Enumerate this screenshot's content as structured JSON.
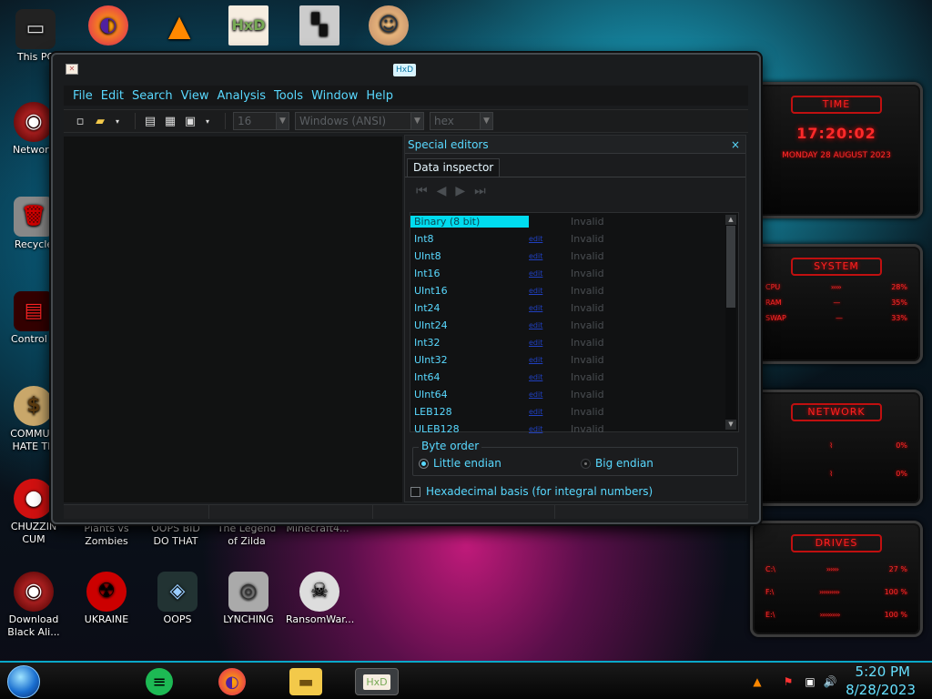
{
  "desktop_icons": [
    {
      "label": "This PC"
    },
    {
      "label": "Network"
    },
    {
      "label": "Recycle"
    },
    {
      "label": "Control P"
    },
    {
      "label": "COMMUN HATE TH"
    },
    {
      "label": "CHUZZIN CUM"
    },
    {
      "label": "Plants vs Zombies"
    },
    {
      "label": "OOPS BID DO THAT"
    },
    {
      "label": "The Legend of Zilda"
    },
    {
      "label": "Minecraft4..."
    },
    {
      "label": "Download Black Ali..."
    },
    {
      "label": "UKRAINE"
    },
    {
      "label": "OOPS"
    },
    {
      "label": "LYNCHING"
    },
    {
      "label": "RansomWar..."
    }
  ],
  "gadgets": {
    "time": {
      "title": "TIME",
      "clock": "17:20:02",
      "date": "MONDAY 28 AUGUST 2023"
    },
    "system": {
      "title": "SYSTEM",
      "rows": [
        {
          "label": "CPU",
          "value": "28%"
        },
        {
          "label": "RAM",
          "value": "35%"
        },
        {
          "label": "SWAP",
          "value": "33%"
        }
      ]
    },
    "network": {
      "title": "NETWORK",
      "rows": [
        {
          "label": "",
          "value": "0%"
        },
        {
          "label": "",
          "value": "0%"
        }
      ]
    },
    "drives": {
      "title": "DRIVES",
      "rows": [
        {
          "label": "C:\\",
          "value": "27 %"
        },
        {
          "label": "F:\\",
          "value": "100 %"
        },
        {
          "label": "E:\\",
          "value": "100 %"
        }
      ]
    }
  },
  "window": {
    "title": "HxD",
    "menu": [
      "File",
      "Edit",
      "Search",
      "View",
      "Analysis",
      "Tools",
      "Window",
      "Help"
    ],
    "toolbar": {
      "bytes_per_row": "16",
      "charset": "Windows (ANSI)",
      "offset_base": "hex"
    },
    "special_editors": {
      "title": "Special editors",
      "close": "×",
      "tab": "Data inspector",
      "rows": [
        {
          "name": "Binary (8 bit)",
          "value": "Invalid",
          "selected": true
        },
        {
          "name": "Int8",
          "edit": "edit",
          "value": "Invalid"
        },
        {
          "name": "UInt8",
          "edit": "edit",
          "value": "Invalid"
        },
        {
          "name": "Int16",
          "edit": "edit",
          "value": "Invalid"
        },
        {
          "name": "UInt16",
          "edit": "edit",
          "value": "Invalid"
        },
        {
          "name": "Int24",
          "edit": "edit",
          "value": "Invalid"
        },
        {
          "name": "UInt24",
          "edit": "edit",
          "value": "Invalid"
        },
        {
          "name": "Int32",
          "edit": "edit",
          "value": "Invalid"
        },
        {
          "name": "UInt32",
          "edit": "edit",
          "value": "Invalid"
        },
        {
          "name": "Int64",
          "edit": "edit",
          "value": "Invalid"
        },
        {
          "name": "UInt64",
          "edit": "edit",
          "value": "Invalid"
        },
        {
          "name": "LEB128",
          "edit": "edit",
          "value": "Invalid"
        },
        {
          "name": "ULEB128",
          "edit": "edit",
          "value": "Invalid"
        }
      ],
      "byte_order": {
        "legend": "Byte order",
        "little": "Little endian",
        "big": "Big endian"
      },
      "hex_basis": "Hexadecimal basis (for integral numbers)"
    }
  },
  "taskbar": {
    "time": "5:20 PM",
    "date": "8/28/2023"
  }
}
